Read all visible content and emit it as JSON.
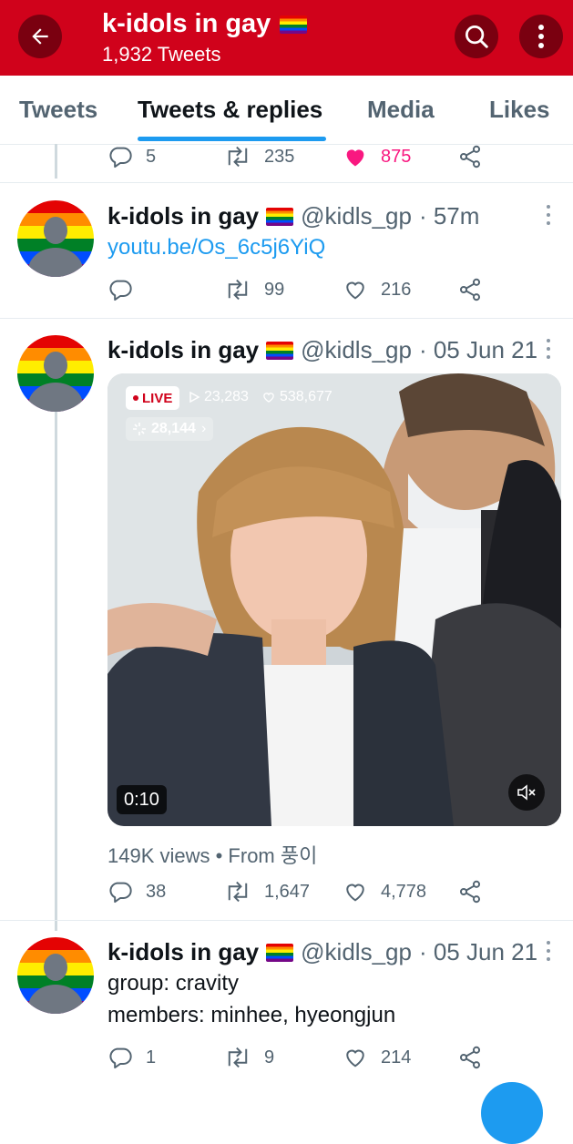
{
  "header": {
    "title": "k-idols in gay",
    "tweet_count": "1,932 Tweets",
    "back_icon": "arrow-left-icon",
    "search_icon": "search-icon",
    "more_icon": "more-vertical-icon",
    "color": "#d0021b"
  },
  "tabs": [
    {
      "label": "Tweets",
      "active": false
    },
    {
      "label": "Tweets & replies",
      "active": true
    },
    {
      "label": "Media",
      "active": false
    },
    {
      "label": "Likes",
      "active": false
    }
  ],
  "tweets": [
    {
      "actions": {
        "replies": "5",
        "retweets": "235",
        "likes": "875",
        "liked": true
      }
    },
    {
      "name": "k-idols in gay",
      "handle": "@kidls_gp",
      "time": "· 57m",
      "link": "youtu.be/Os_6c5j6YiQ",
      "actions": {
        "replies": "",
        "retweets": "99",
        "likes": "216"
      }
    },
    {
      "name": "k-idols in gay",
      "handle": "@kidls_gp",
      "time": "· 05 Jun 21",
      "media": {
        "live_label": "LIVE",
        "plays": "23,283",
        "hearts": "538,677",
        "viewers": "28,144",
        "duration": "0:10"
      },
      "views": "149K views • From 풍이",
      "actions": {
        "replies": "38",
        "retweets": "1,647",
        "likes": "4,778"
      }
    },
    {
      "name": "k-idols in gay",
      "handle": "@kidls_gp",
      "time": "· 05 Jun 21",
      "text_line1": "group: cravity",
      "text_line2": "members: minhee, hyeongjun",
      "actions": {
        "replies": "1",
        "retweets": "9",
        "likes": "214"
      }
    }
  ],
  "colors": {
    "accent": "#1d9bf0",
    "like": "#f91880",
    "muted": "#536471"
  }
}
